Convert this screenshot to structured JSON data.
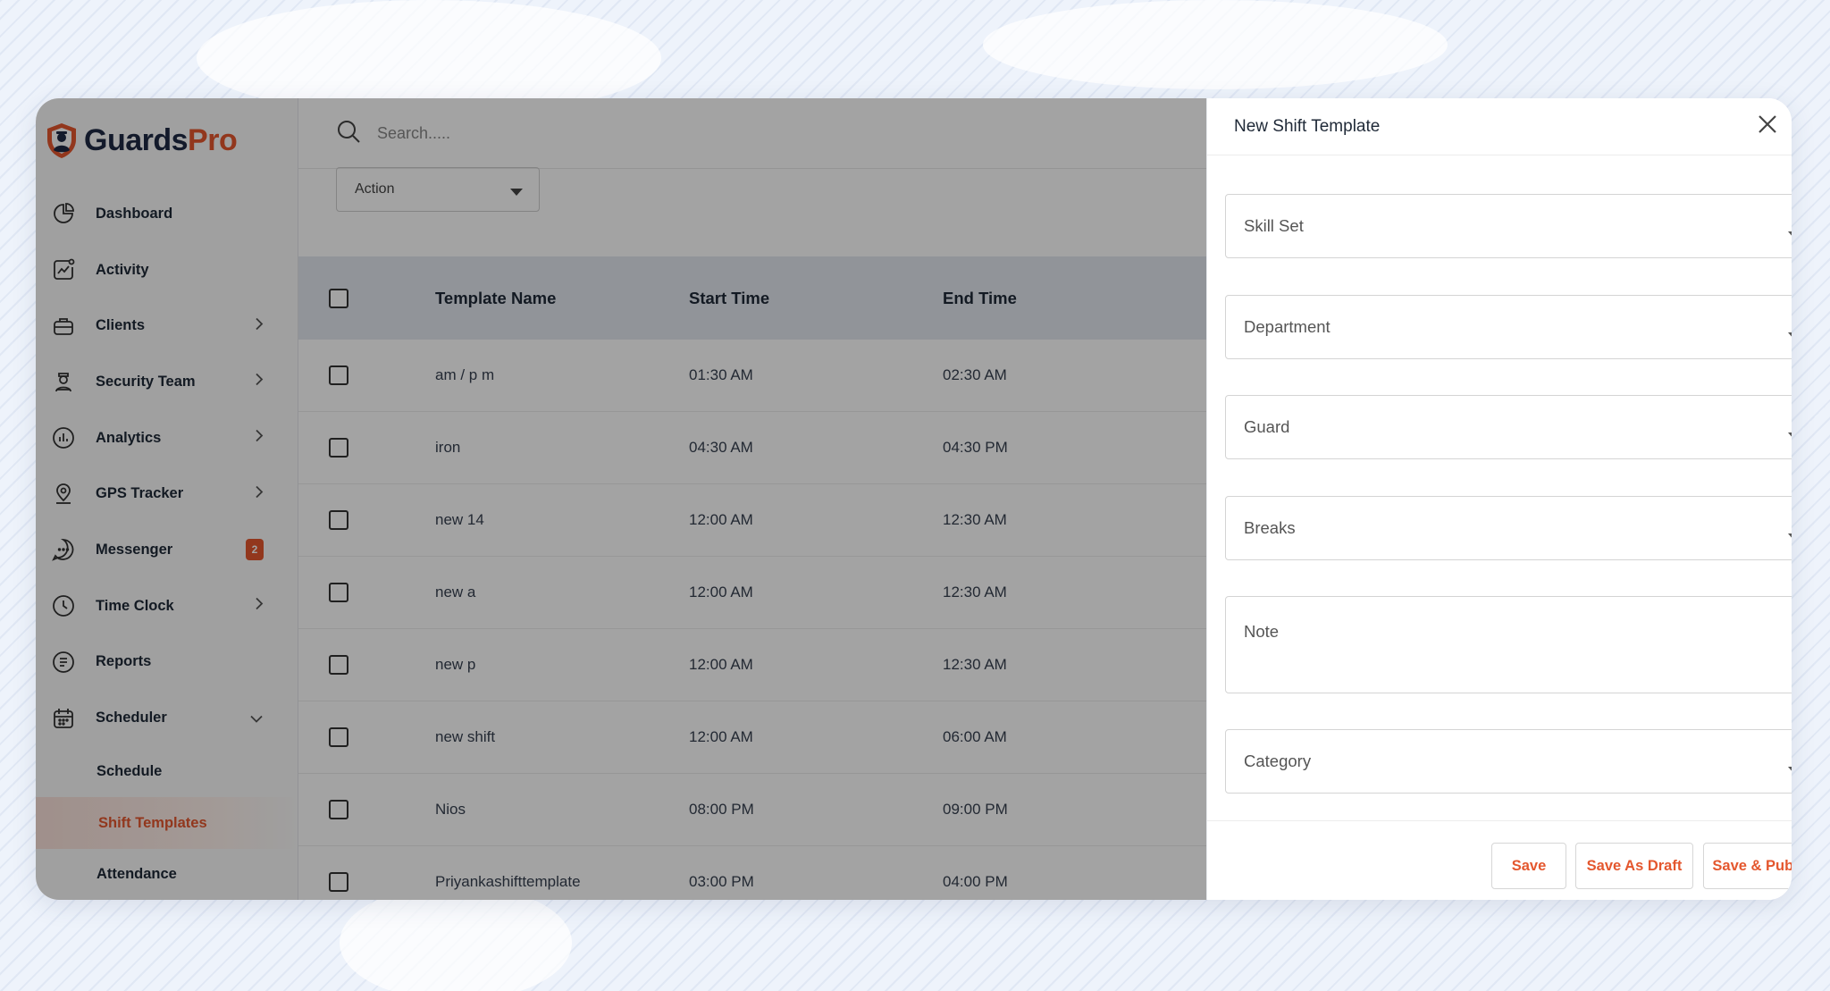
{
  "brand": {
    "name_part1": "Guards",
    "name_part2": "Pro",
    "accent_color": "#e4572e"
  },
  "sidebar": {
    "items": [
      {
        "label": "Dashboard",
        "icon": "pie-chart-icon",
        "has_chevron": false
      },
      {
        "label": "Activity",
        "icon": "activity-chart-icon",
        "has_chevron": false
      },
      {
        "label": "Clients",
        "icon": "briefcase-icon",
        "has_chevron": true
      },
      {
        "label": "Security Team",
        "icon": "guard-person-icon",
        "has_chevron": true
      },
      {
        "label": "Analytics",
        "icon": "bar-chart-icon",
        "has_chevron": true
      },
      {
        "label": "GPS Tracker",
        "icon": "location-pin-icon",
        "has_chevron": true
      },
      {
        "label": "Messenger",
        "icon": "chat-bubble-icon",
        "badge": "2"
      },
      {
        "label": "Time Clock",
        "icon": "clock-icon",
        "has_chevron": true
      },
      {
        "label": "Reports",
        "icon": "document-icon",
        "has_chevron": false
      },
      {
        "label": "Scheduler",
        "icon": "calendar-icon",
        "expanded": true
      }
    ],
    "sub_items": [
      {
        "label": "Schedule",
        "active": false
      },
      {
        "label": "Shift Templates",
        "active": true
      },
      {
        "label": "Attendance",
        "active": false
      }
    ]
  },
  "search": {
    "placeholder": "Search....."
  },
  "action_select": {
    "value": "Action"
  },
  "table": {
    "headers": [
      "Template Name",
      "Start Time",
      "End Time"
    ],
    "rows": [
      [
        "am / p m",
        "01:30 AM",
        "02:30 AM"
      ],
      [
        "iron",
        "04:30 AM",
        "04:30 PM"
      ],
      [
        "new 14",
        "12:00 AM",
        "12:30 AM"
      ],
      [
        "new a",
        "12:00 AM",
        "12:30 AM"
      ],
      [
        "new p",
        "12:00 AM",
        "12:30 AM"
      ],
      [
        "new shift",
        "12:00 AM",
        "06:00 AM"
      ],
      [
        "Nios",
        "08:00 PM",
        "09:00 PM"
      ],
      [
        "Priyankashifttemplate",
        "03:00 PM",
        "04:00 PM"
      ]
    ]
  },
  "panel": {
    "title": "New Shift Template",
    "fields": {
      "skill_set": "Skill Set",
      "department": "Department",
      "guard": "Guard",
      "breaks": "Breaks",
      "note": "Note",
      "category": "Category"
    },
    "buttons": {
      "save": "Save",
      "save_draft": "Save As Draft",
      "save_publish": "Save & Publish"
    }
  }
}
